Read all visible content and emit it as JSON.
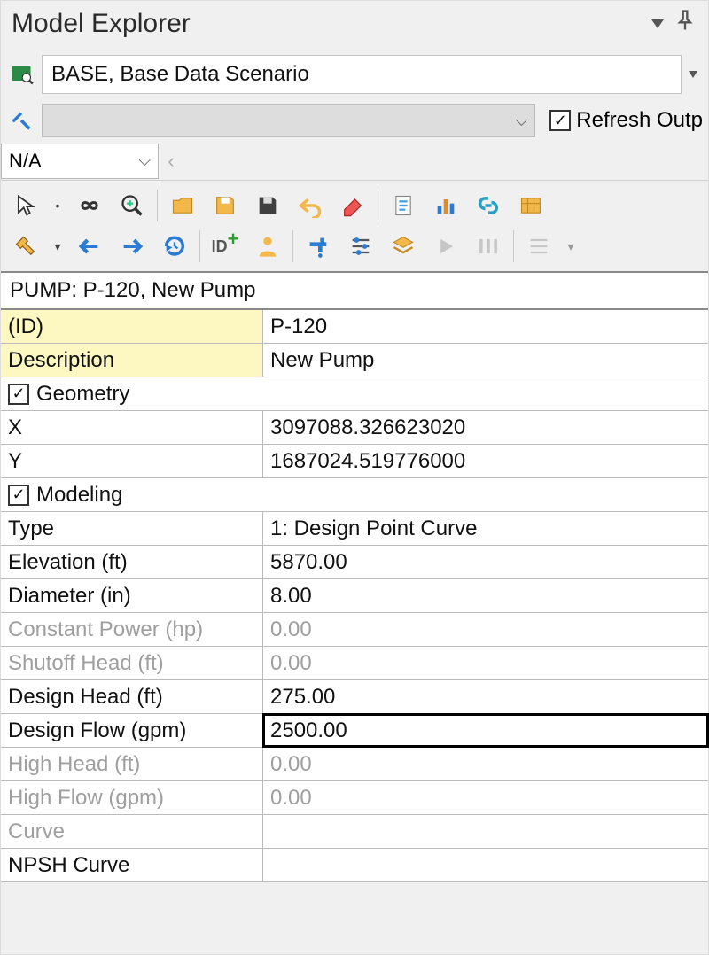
{
  "panel": {
    "title": "Model Explorer"
  },
  "scenario": {
    "value": "BASE, Base Data Scenario"
  },
  "refresh": {
    "label": "Refresh Outp",
    "checked": true
  },
  "na_combo": {
    "value": "N/A"
  },
  "element": {
    "label": "PUMP: P-120, New Pump"
  },
  "props": {
    "id_label": "(ID)",
    "id_value": "P-120",
    "desc_label": "Description",
    "desc_value": "New Pump",
    "section_geometry": "Geometry",
    "x_label": "X",
    "x_value": "3097088.326623020",
    "y_label": "Y",
    "y_value": "1687024.519776000",
    "section_modeling": "Modeling",
    "type_label": "Type",
    "type_value": "1: Design Point Curve",
    "elev_label": "Elevation (ft)",
    "elev_value": "5870.00",
    "diam_label": "Diameter (in)",
    "diam_value": "8.00",
    "cpower_label": "Constant Power (hp)",
    "cpower_value": "0.00",
    "shutoff_label": "Shutoff Head (ft)",
    "shutoff_value": "0.00",
    "dhead_label": "Design Head (ft)",
    "dhead_value": "275.00",
    "dflow_label": "Design Flow (gpm)",
    "dflow_value": "2500.00",
    "hhead_label": "High Head (ft)",
    "hhead_value": "0.00",
    "hflow_label": "High Flow (gpm)",
    "hflow_value": "0.00",
    "curve_label": "Curve",
    "curve_value": "",
    "npsh_label": "NPSH Curve",
    "npsh_value": ""
  }
}
